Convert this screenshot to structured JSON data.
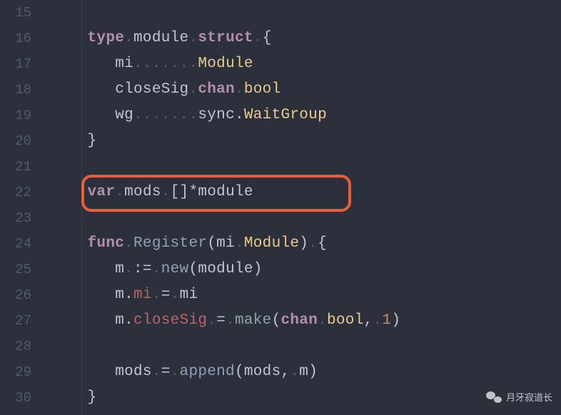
{
  "gutter": {
    "lines": [
      "15",
      "16",
      "17",
      "18",
      "19",
      "20",
      "21",
      "22",
      "23",
      "24",
      "25",
      "26",
      "27",
      "28",
      "29",
      "30"
    ]
  },
  "code": {
    "l15": {
      "blank": ""
    },
    "l16": {
      "kw_type": "type",
      "dot": ".",
      "id": "module",
      "kw_struct": "struct",
      "dot2": ".",
      "brace": "{"
    },
    "l17": {
      "field": "mi",
      "dots": ".......",
      "type": "Module"
    },
    "l18": {
      "field": "closeSig",
      "dot": ".",
      "kw_chan": "chan",
      "dot2": ".",
      "type": "bool"
    },
    "l19": {
      "field": "wg",
      "dots": ".......",
      "pkg": "sync.",
      "type": "WaitGroup"
    },
    "l20": {
      "brace": "}"
    },
    "l21": {
      "blank": ""
    },
    "l22": {
      "kw_var": "var",
      "dot": ".",
      "id": "mods",
      "dot2": ".",
      "brackets": "[]*",
      "type": "module"
    },
    "l23": {
      "blank": ""
    },
    "l24": {
      "kw_func": "func",
      "dot": ".",
      "name": "Register",
      "lp": "(",
      "param": "mi",
      "dot2": ".",
      "ptype": "Module",
      "rp": ")",
      "dot3": ".",
      "brace": "{"
    },
    "l25": {
      "v": "m",
      "dot": ".",
      "op": ":=",
      "dot2": ".",
      "fn": "new",
      "lp": "(",
      "arg": "module",
      "rp": ")"
    },
    "l26": {
      "v": "m",
      "dot": ".",
      "field": "mi",
      "dot2": ".",
      "eq": "=",
      "dot3": ".",
      "rhs": "mi"
    },
    "l27": {
      "v": "m",
      "dot": ".",
      "field": "closeSig",
      "dot2": ".",
      "eq": "=",
      "dot3": ".",
      "fn": "make",
      "lp": "(",
      "kw_chan": "chan",
      "dot4": ".",
      "type": "bool",
      "comma": ",",
      "dot5": ".",
      "num": "1",
      "rp": ")"
    },
    "l28": {
      "blank": ""
    },
    "l29": {
      "v": "mods",
      "dot": ".",
      "eq": "=",
      "dot2": ".",
      "fn": "append",
      "lp": "(",
      "a1": "mods",
      "comma": ",",
      "dot3": ".",
      "a2": "m",
      "rp": ")"
    },
    "l30": {
      "brace": "}"
    }
  },
  "watermark": {
    "text": "月牙寂道长"
  }
}
